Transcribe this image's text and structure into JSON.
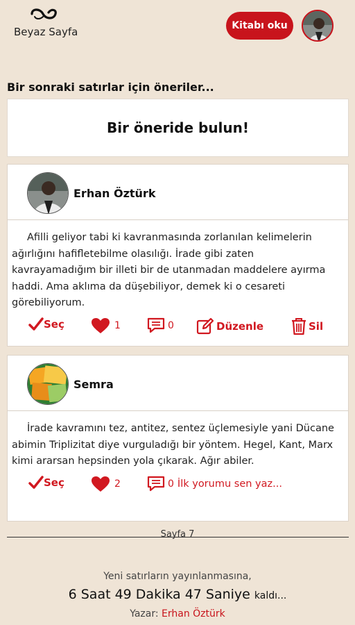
{
  "header": {
    "logo_text": "Beyaz Sayfa",
    "read_button": "Kitabı oku"
  },
  "section_title": "Bir sonraki satırlar için öneriler...",
  "find_box": "Bir öneride bulun!",
  "cards": [
    {
      "author": "Erhan Öztürk",
      "text": "Afilli geliyor tabi ki kavranmasında zorlanılan kelimelerin ağırlığını hafifletebilme olasılığı. İrade gibi zaten kavrayamadığım bir illeti bir de utanmadan maddelere ayırma haddi. Ama aklıma da düşebiliyor, demek ki o cesareti görebiliyorum.",
      "select_label": "Seç",
      "likes": "1",
      "comments": "0",
      "edit_label": "Düzenle",
      "delete_label": "Sil"
    },
    {
      "author": "Semra",
      "text": "İrade kavramını tez, antitez, sentez üçlemesiyle yani Dücane abimin Triplizitat diye vurguladığı bir yöntem. Hegel, Kant, Marx kimi ararsan hepsinden yola çıkarak. Ağır abiler.",
      "select_label": "Seç",
      "likes": "2",
      "comments": "0",
      "first_comment_label": "İlk yorumu sen yaz..."
    }
  ],
  "page_label": "Sayfa 7",
  "footer": {
    "line1": "Yeni satırların yayınlanmasına,",
    "countdown": "6 Saat 49 Dakika 47 Saniye",
    "countdown_suffix": "kaldı...",
    "author_prefix": "Yazar:",
    "author_name": "Erhan Öztürk"
  },
  "colors": {
    "background": "#efe4d6",
    "accent": "#c8141c"
  }
}
